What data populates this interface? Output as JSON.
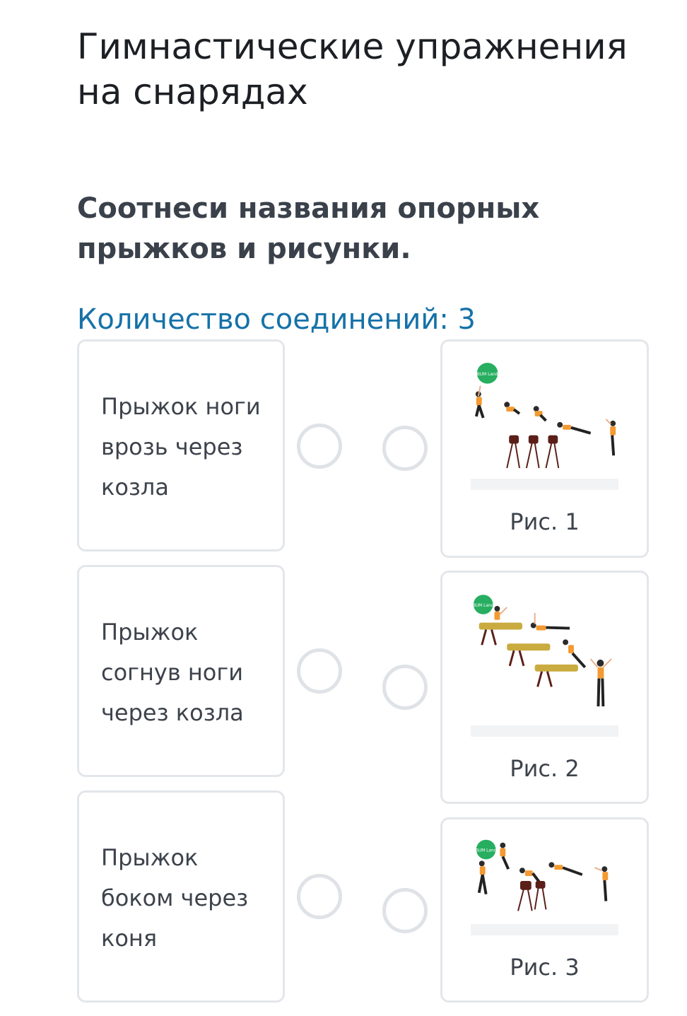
{
  "page_title": "Гимнастические упражнения на снарядах",
  "task": "Соотнеси названия опорных прыжков и рисунки.",
  "counter": "Количество соединений: 3",
  "left_items": [
    {
      "label": "Прыжок ноги врозь через козла"
    },
    {
      "label": "Прыжок согнув ноги через козла"
    },
    {
      "label": "Прыжок боком через коня"
    }
  ],
  "right_items": [
    {
      "caption": "Рис. 1",
      "logo_text": "BUM Land"
    },
    {
      "caption": "Рис. 2",
      "logo_text": "BUM Land"
    },
    {
      "caption": "Рис. 3",
      "logo_text": "BUM Land"
    }
  ],
  "colors": {
    "accent": "#1672a8",
    "card_border": "#e3e6ea",
    "radio_border": "#dfe2e6",
    "logo_green": "#27ae60",
    "shirt_orange": "#f39a32",
    "apparatus_wood": "#c9ab3f",
    "apparatus_dark": "#5b1f18"
  }
}
